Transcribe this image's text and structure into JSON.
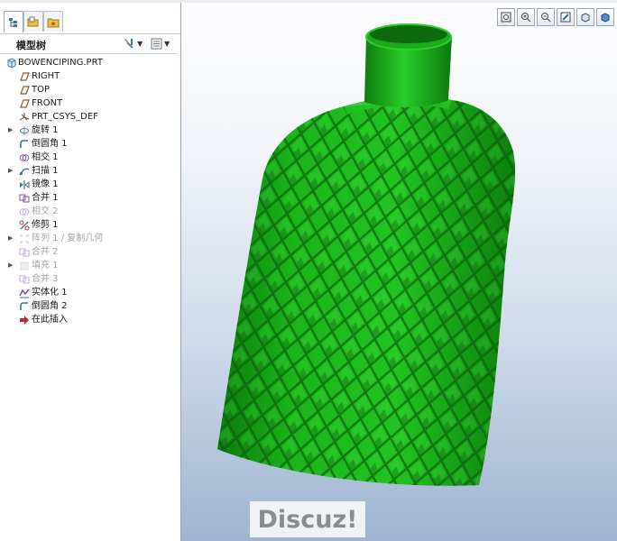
{
  "model_tree": {
    "title": "模型树",
    "root": "BOWENCIPING.PRT",
    "items": [
      {
        "label": "RIGHT",
        "icon": "datum-plane-icon",
        "expand": false,
        "dim": false
      },
      {
        "label": "TOP",
        "icon": "datum-plane-icon",
        "expand": false,
        "dim": false
      },
      {
        "label": "FRONT",
        "icon": "datum-plane-icon",
        "expand": false,
        "dim": false
      },
      {
        "label": "PRT_CSYS_DEF",
        "icon": "csys-icon",
        "expand": false,
        "dim": false
      },
      {
        "label": "旋转 1",
        "icon": "revolve-icon",
        "expand": true,
        "dim": false
      },
      {
        "label": "倒圆角 1",
        "icon": "round-icon",
        "expand": false,
        "dim": false
      },
      {
        "label": "相交 1",
        "icon": "intersect-icon",
        "expand": false,
        "dim": false
      },
      {
        "label": "扫描 1",
        "icon": "sweep-icon",
        "expand": true,
        "dim": false
      },
      {
        "label": "镜像 1",
        "icon": "mirror-icon",
        "expand": false,
        "dim": false
      },
      {
        "label": "合并 1",
        "icon": "merge-icon",
        "expand": false,
        "dim": false
      },
      {
        "label": "相交 2",
        "icon": "intersect-icon",
        "expand": false,
        "dim": true
      },
      {
        "label": "修剪 1",
        "icon": "trim-icon",
        "expand": false,
        "dim": false
      },
      {
        "label": "阵列 1 / 复制几何",
        "icon": "pattern-icon",
        "expand": true,
        "dim": true
      },
      {
        "label": "合并 2",
        "icon": "merge-icon",
        "expand": false,
        "dim": true
      },
      {
        "label": "填充 1",
        "icon": "fill-icon",
        "expand": true,
        "dim": true
      },
      {
        "label": "合并 3",
        "icon": "merge-icon",
        "expand": false,
        "dim": true
      },
      {
        "label": "实体化 1",
        "icon": "solidify-icon",
        "expand": false,
        "dim": false
      },
      {
        "label": "倒圆角 2",
        "icon": "round-icon",
        "expand": false,
        "dim": false
      },
      {
        "label": "在此插入",
        "icon": "insert-here-arrow-icon",
        "expand": false,
        "dim": false
      }
    ]
  },
  "watermark": "Discuz!",
  "colors": {
    "model_green": "#1fb41f",
    "insert_arrow": "#c62828"
  }
}
